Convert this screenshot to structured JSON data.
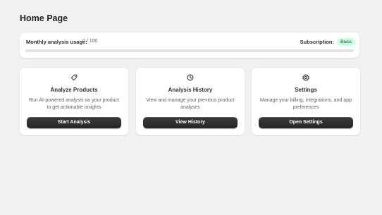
{
  "page": {
    "title": "Home Page"
  },
  "usage": {
    "label": "Monthly analysis usage:",
    "value": "0 / 100",
    "progress_fraction": 0,
    "subscription_label": "Subscription:",
    "subscription_plan": "Basic",
    "badge_color": "#cdfee1"
  },
  "cards": [
    {
      "icon": "tag-icon",
      "title": "Analyze Products",
      "description": "Run AI-powered analysis on your product to get actionable insights",
      "button": "Start Analysis"
    },
    {
      "icon": "clock-icon",
      "title": "Analysis History",
      "description": "View and manage your previous product analyses",
      "button": "View History"
    },
    {
      "icon": "gear-icon",
      "title": "Settings",
      "description": "Manage your billing, integrations, and app preferences",
      "button": "Open Settings"
    }
  ]
}
